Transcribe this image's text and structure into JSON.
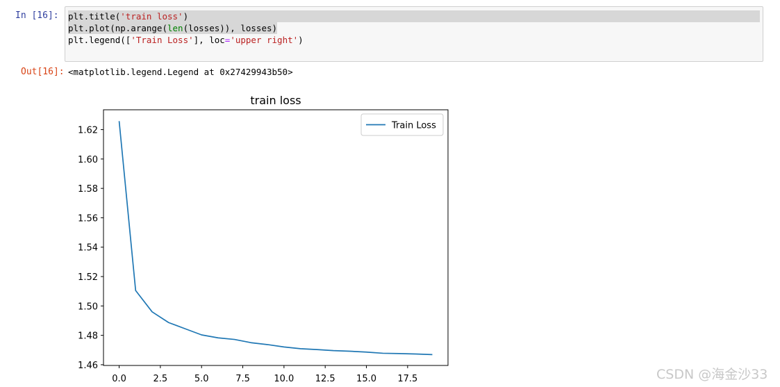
{
  "cell": {
    "in_prompt": "In  [16]:",
    "out_prompt": "Out[16]:",
    "code": {
      "line1": {
        "a": "plt.title(",
        "s": "'train loss'",
        "b": ")"
      },
      "line2": {
        "a": "plt.plot(np.arange(",
        "fn": "len",
        "b": "(losses)), losses)"
      },
      "line3": {
        "a": "plt.legend([",
        "s1": "'Train Loss'",
        "b": "], loc",
        "op": "=",
        "s2": "'upper right'",
        "c": ")"
      }
    },
    "output_text": "<matplotlib.legend.Legend at 0x27429943b50>"
  },
  "chart_data": {
    "type": "line",
    "title": "train loss",
    "xlabel": "",
    "ylabel": "",
    "xlim": [
      -0.95,
      19.95
    ],
    "ylim": [
      1.4595,
      1.6335
    ],
    "x_ticks": [
      0.0,
      2.5,
      5.0,
      7.5,
      10.0,
      12.5,
      15.0,
      17.5
    ],
    "x_tick_labels": [
      "0.0",
      "2.5",
      "5.0",
      "7.5",
      "10.0",
      "12.5",
      "15.0",
      "17.5"
    ],
    "y_ticks": [
      1.46,
      1.48,
      1.5,
      1.52,
      1.54,
      1.56,
      1.58,
      1.6,
      1.62
    ],
    "y_tick_labels": [
      "1.46",
      "1.48",
      "1.50",
      "1.52",
      "1.54",
      "1.56",
      "1.58",
      "1.60",
      "1.62"
    ],
    "grid": false,
    "legend_position": "upper right",
    "series": [
      {
        "name": "Train Loss",
        "color": "#1f77b4",
        "x": [
          0,
          1,
          2,
          3,
          4,
          5,
          6,
          7,
          8,
          9,
          10,
          11,
          12,
          13,
          14,
          15,
          16,
          17,
          18,
          19
        ],
        "values": [
          1.6258,
          1.5105,
          1.496,
          1.4887,
          1.4845,
          1.4803,
          1.4783,
          1.4772,
          1.475,
          1.4737,
          1.4721,
          1.4709,
          1.4703,
          1.4696,
          1.4692,
          1.4686,
          1.4678,
          1.4676,
          1.4673,
          1.4669
        ]
      }
    ]
  },
  "watermark": "CSDN @海金沙33"
}
